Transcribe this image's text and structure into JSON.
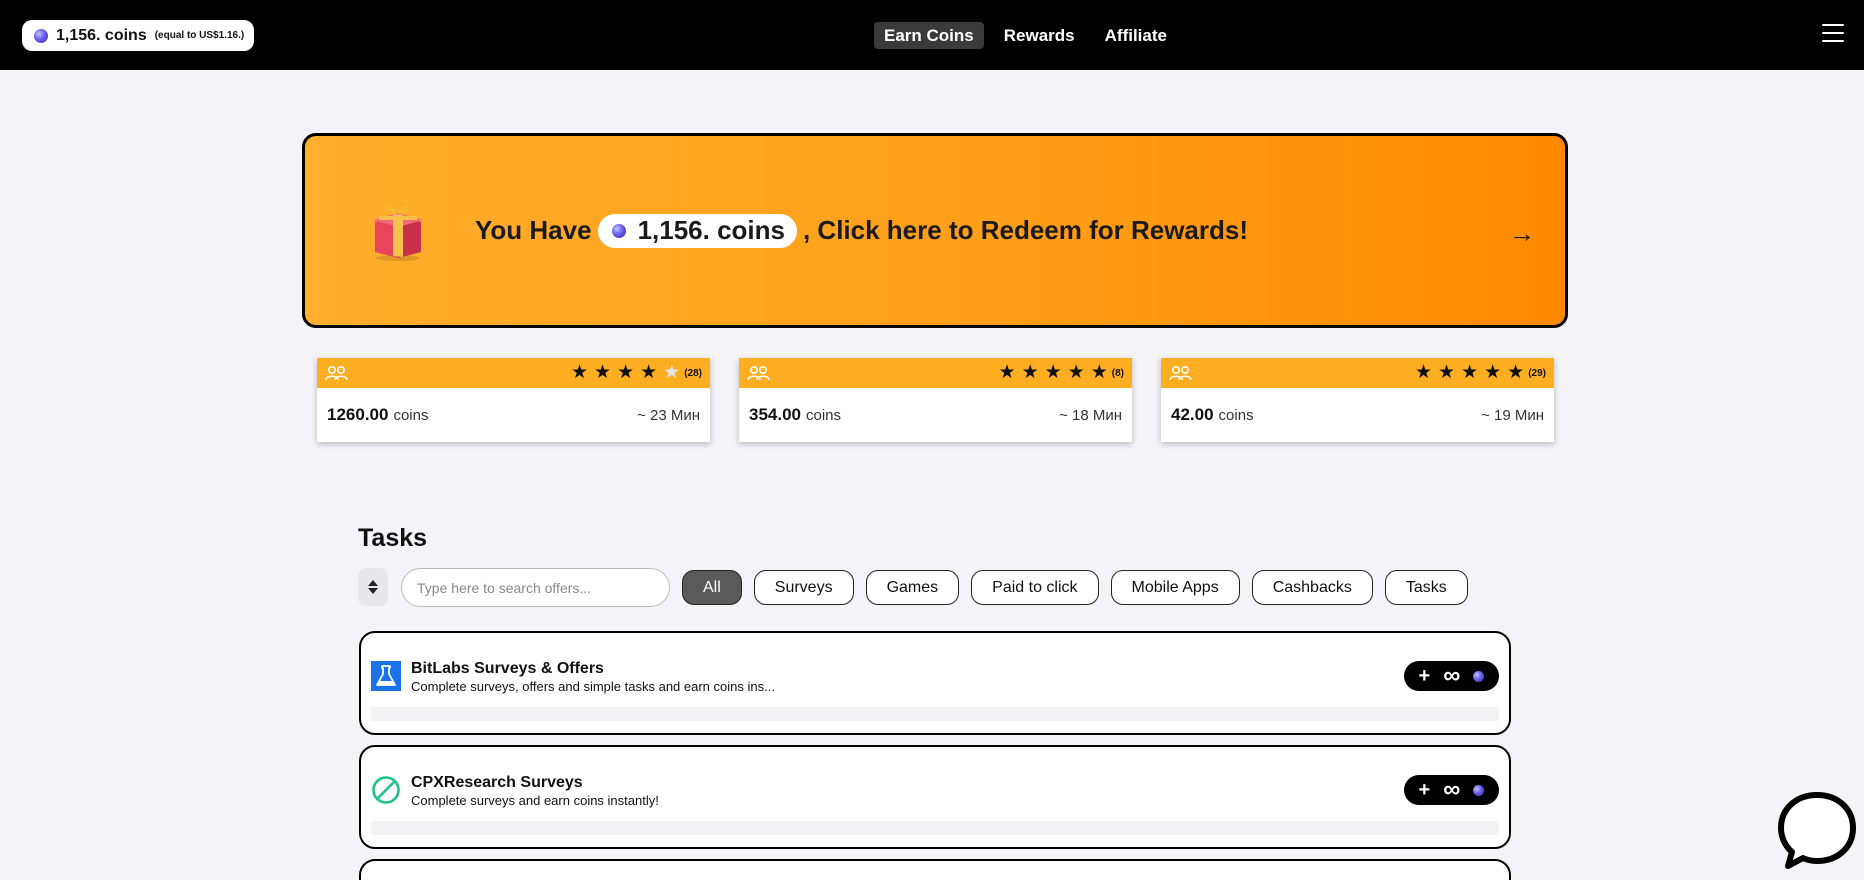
{
  "header": {
    "coins": "1,156. coins",
    "coins_equal": "(equal to US$1.16.)",
    "nav": [
      {
        "label": "Earn Coins",
        "active": true
      },
      {
        "label": "Rewards",
        "active": false
      },
      {
        "label": "Affiliate",
        "active": false
      }
    ],
    "menu_icon": "hamburger-icon"
  },
  "banner": {
    "prefix": "You Have",
    "coins": "1,156. coins",
    "suffix": ", Click here to Redeem for Rewards!",
    "icon": "gift-icon",
    "arrow": "→"
  },
  "offers": [
    {
      "coins": "1260.00",
      "unit": "coins",
      "time": "~ 23 Мин",
      "rating": 4,
      "reviews": "(28)"
    },
    {
      "coins": "354.00",
      "unit": "coins",
      "time": "~ 18 Мин",
      "rating": 5,
      "reviews": "(8)"
    },
    {
      "coins": "42.00",
      "unit": "coins",
      "time": "~ 19 Мин",
      "rating": 5,
      "reviews": "(29)"
    }
  ],
  "tasks": {
    "title": "Tasks",
    "search_placeholder": "Type here to search offers...",
    "filters": [
      {
        "label": "All",
        "active": true
      },
      {
        "label": "Surveys",
        "active": false
      },
      {
        "label": "Games",
        "active": false
      },
      {
        "label": "Paid to click",
        "active": false
      },
      {
        "label": "Mobile Apps",
        "active": false
      },
      {
        "label": "Cashbacks",
        "active": false
      },
      {
        "label": "Tasks",
        "active": false
      }
    ],
    "items": [
      {
        "name": "BitLabs Surveys & Offers",
        "description": "Complete surveys, offers and simple tasks and earn coins ins...",
        "reward_plus": "+",
        "reward_value": "∞",
        "logo": "flask-icon"
      },
      {
        "name": "CPXResearch Surveys",
        "description": "Complete surveys and earn coins instantly!",
        "reward_plus": "+",
        "reward_value": "∞",
        "logo": "cpx-check-icon"
      }
    ]
  },
  "colors": {
    "topbar": "#000000",
    "banner": "#ff9e18",
    "offer_header": "#ffae21",
    "bitlabs": "#1a73e8",
    "cpx": "#1ec28b"
  }
}
